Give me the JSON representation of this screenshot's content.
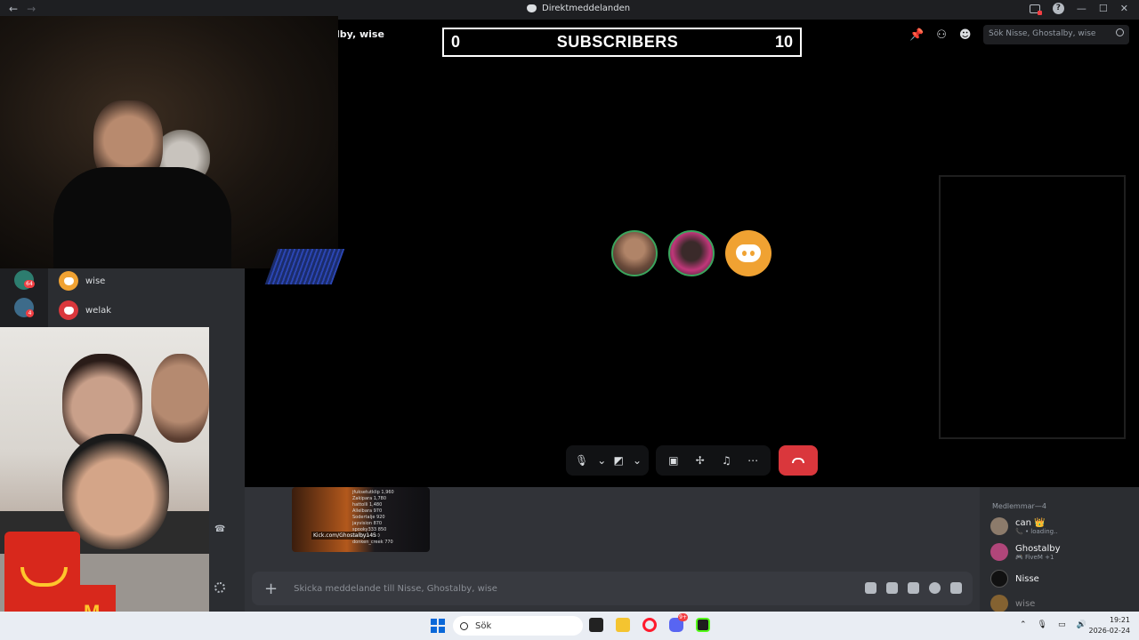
{
  "window": {
    "title": "Direktmeddelanden",
    "nav_back": "←",
    "nav_forward": "→",
    "minimize": "—",
    "maximize": "☐",
    "close": "✕"
  },
  "channel": {
    "name": "lby, wise"
  },
  "overlay": {
    "left_count": "0",
    "label": "SUBSCRIBERS",
    "right_count": "10"
  },
  "toolbar": {
    "pin": "📌",
    "add_friends": "⚇",
    "members": "☻",
    "search_placeholder": "Sök Nisse, Ghostalby, wise"
  },
  "callbar": {
    "mic": "🎙",
    "mic_chevron": "⌄",
    "camera": "◩",
    "camera_chevron": "⌄",
    "screen": "▣",
    "activity": "✢",
    "soundboard": "♫",
    "more": "⋯"
  },
  "dms": [
    {
      "name": "wise",
      "color": "#f0a232"
    },
    {
      "name": "welak",
      "color": "#da373c"
    }
  ],
  "servers": [
    {
      "badge": "64"
    },
    {
      "badge": "4"
    }
  ],
  "thumbnail": {
    "link": "Kick.com/Ghostalby145",
    "list": [
      "jfuksetutklip 1,960",
      "Zakipara 1,780",
      "hattolli 1,480",
      "Allelbara 970",
      "Sodertalje 920",
      "jayvision 870",
      "spooky333 850",
      "bonjji1x 860",
      "donken_creek 770",
      "Zakil16 770"
    ]
  },
  "composer": {
    "plus": "+",
    "placeholder": "Skicka meddelande till Nisse, Ghostalby, wise"
  },
  "members": {
    "header": "Medlemmar—4",
    "list": [
      {
        "name": "can 👑",
        "status": "📞 • loading..",
        "color": "#8c7b6b"
      },
      {
        "name": "Ghostalby",
        "status": "🎮 FiveM +1",
        "color": "#b0467a"
      },
      {
        "name": "Nisse",
        "status": "",
        "color": "#111111"
      },
      {
        "name": "wise",
        "status": "",
        "color": "#f0a232"
      }
    ]
  },
  "taskbar": {
    "search": "Sök",
    "time": "19:21",
    "date": "2026-02-24",
    "discord_badge": "9+"
  }
}
